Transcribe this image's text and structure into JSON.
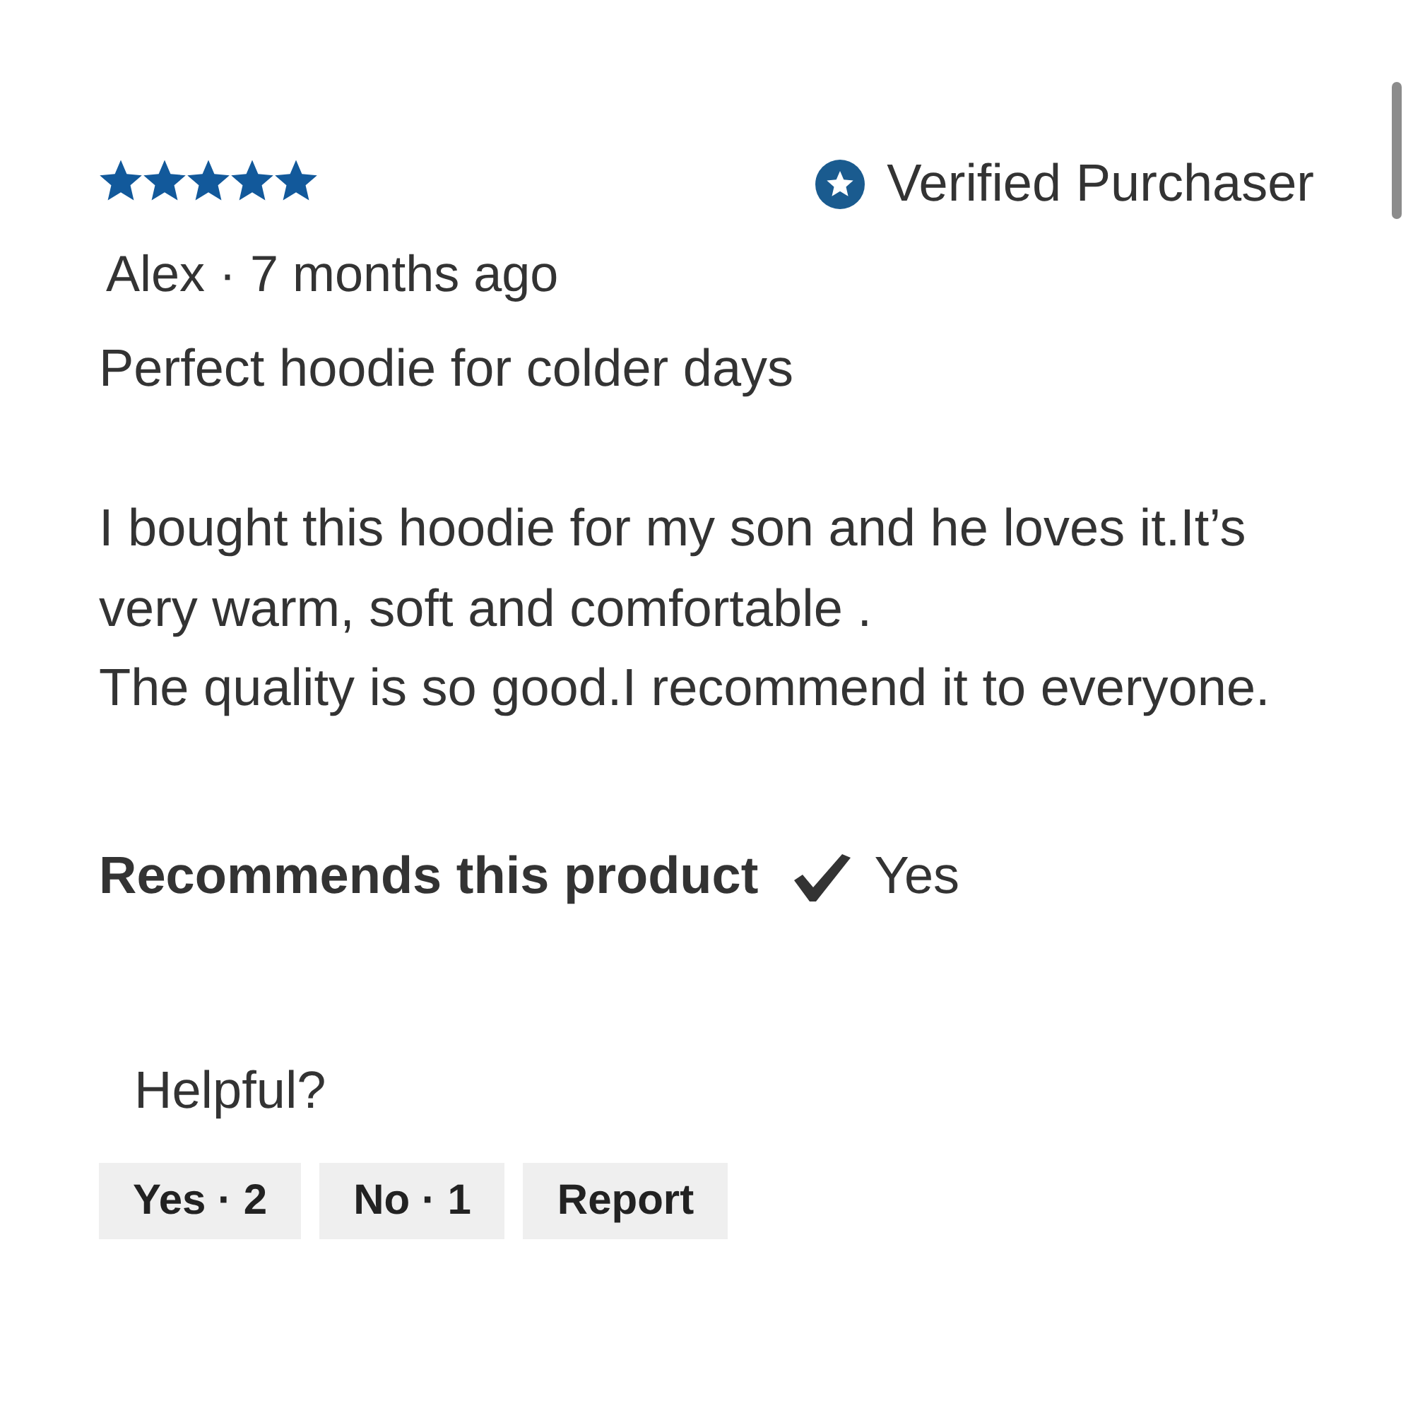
{
  "review": {
    "stars": 5,
    "verified_label": "Verified Purchaser",
    "byline": "Alex · 7 months ago",
    "title": "Perfect hoodie for colder days",
    "body_lines": [
      "I bought this hoodie for my son and he loves it.It’s",
      "very warm, soft and comfortable .",
      "The quality is so good.I recommend it to everyone."
    ],
    "recommendation": {
      "label": "Recommends this product",
      "checked": true,
      "answer": "Yes"
    },
    "helpful": {
      "label": "Helpful?",
      "buttons": [
        {
          "label": "Yes · 2"
        },
        {
          "label": "No · 1"
        },
        {
          "label": "Report"
        }
      ]
    }
  }
}
